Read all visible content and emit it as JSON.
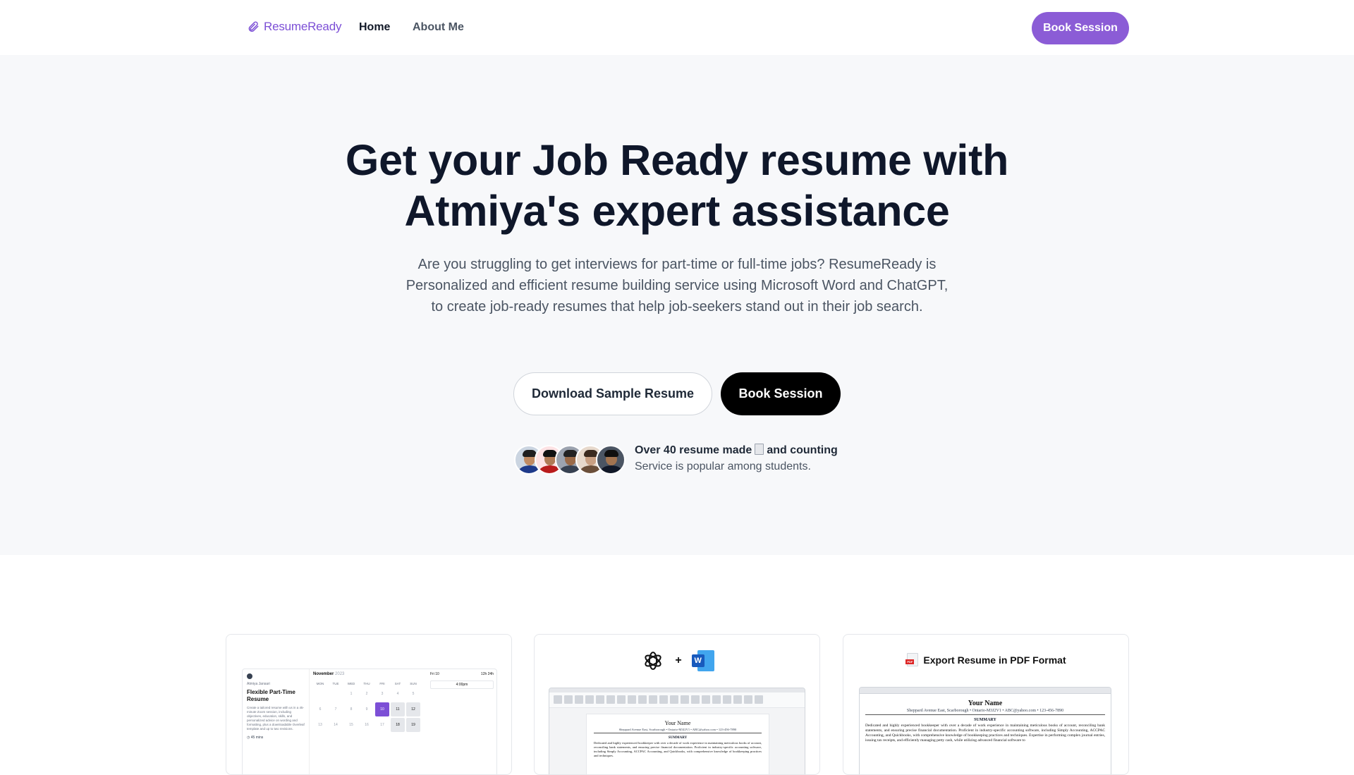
{
  "nav": {
    "logo_text": "ResumeReady",
    "links": [
      {
        "label": "Home"
      },
      {
        "label": "About Me"
      }
    ],
    "cta_label": "Book Session"
  },
  "hero": {
    "title_line1": "Get your Job Ready resume with",
    "title_line2": "Atmiya's expert assistance",
    "subtitle": "Are you struggling to get interviews for part-time or full-time jobs? ResumeReady is Personalized and efficient resume building service using Microsoft Word and ChatGPT, to create job-ready resumes that help job-seekers stand out in their job search.",
    "btn_download": "Download Sample Resume",
    "btn_book": "Book Session",
    "proof_title_a": "Over 40 resume made",
    "proof_title_b": "and counting",
    "proof_sub": "Service is popular among students."
  },
  "cards": {
    "calendar": {
      "name": "Atmiya Jansari",
      "title": "Flexible Part-Time Resume",
      "desc": "Create a tailored resume with us in a 45-minute Zoom session, including objectives, education, skills, and personalized advice on wording and formatting, plus a downloadable Overleaf template and up to two revisions.",
      "duration": "45 mins",
      "month": "November",
      "year": "2023",
      "weekdays": [
        "MON",
        "TUE",
        "WED",
        "THU",
        "FRI",
        "SAT",
        "SUN"
      ],
      "day_label": "Fri 10",
      "toggle_a": "12h",
      "toggle_b": "24h",
      "slot": "4:00pm"
    },
    "tools": {
      "plus": "+",
      "word_letter": "W",
      "doc_name": "Your Name",
      "doc_contact": "Sheppard Avenue East, Scarborough • Ontario-M3J2V1 • ABC@yahoo.com • 123-456-7890",
      "doc_summary": "SUMMARY",
      "doc_body": "Dedicated and highly experienced bookkeeper with over a decade of work experience in maintaining meticulous books of account, reconciling bank statements, and ensuring precise financial documentation. Proficient in industry-specific accounting software, including Simply Accounting, ACCPAC Accounting, and Quickbooks, with comprehensive knowledge of bookkeeping practices and techniques."
    },
    "pdf": {
      "badge": "PDF",
      "label": "Export Resume in PDF Format",
      "doc_name": "Your Name",
      "doc_contact": "Sheppard Avenue East, Scarborough • Ontario-M3J2V1 • ABC@yahoo.com • 123-456-7890",
      "doc_summary": "SUMMARY",
      "doc_body": "Dedicated and highly experienced bookkeeper with over a decade of work experience in maintaining meticulous books of account, reconciling bank statements, and ensuring precise financial documentation. Proficient in industry-specific accounting software, including Simply Accounting, ACCPAC Accounting, and Quickbooks, with comprehensive knowledge of bookkeeping practices and techniques. Expertise in performing complex journal entries, issuing tax receipts, and efficiently managing petty cash, while utilizing advanced financial software to"
    }
  },
  "colors": {
    "brand_purple": "#8b5cd6",
    "logo_purple": "#7c4fd6",
    "hero_bg": "#f7f8fa",
    "dark_button": "#000000"
  },
  "icons": [
    "paperclip-icon",
    "receipt-icon",
    "chatgpt-icon",
    "word-icon",
    "pdf-icon"
  ]
}
